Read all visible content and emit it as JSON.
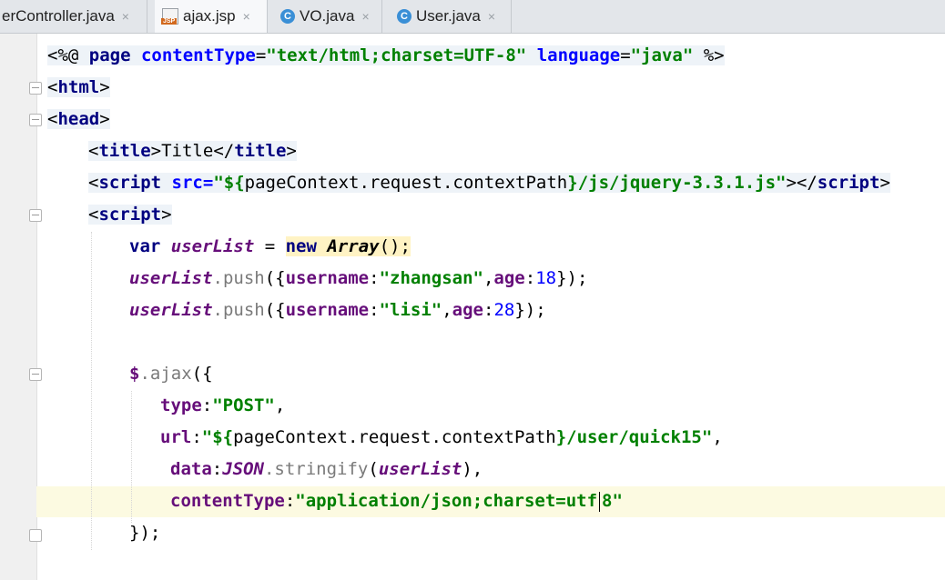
{
  "tabs": [
    {
      "label": "erController.java",
      "icon": "none",
      "active": false
    },
    {
      "label": "ajax.jsp",
      "icon": "jsp-file-icon",
      "active": true
    },
    {
      "label": "VO.java",
      "icon": "class-icon",
      "active": false
    },
    {
      "label": "User.java",
      "icon": "class-icon",
      "active": false
    }
  ],
  "tab_close": "×",
  "jsp_badge": "JSP",
  "class_badge": "C",
  "code": {
    "l1": {
      "a": "<%@ ",
      "b": "page ",
      "c": "contentType",
      "d": "=",
      "e": "\"text/html;charset=UTF-8\"",
      "f": " language",
      "g": "=",
      "h": "\"java\"",
      "i": " %>"
    },
    "l2": {
      "a": "<",
      "b": "html",
      "c": ">"
    },
    "l3": {
      "a": "<",
      "b": "head",
      "c": ">"
    },
    "l4": {
      "a": "<",
      "b": "title",
      "c": ">",
      "d": "Title",
      "e": "</",
      "f": "title",
      "g": ">"
    },
    "l5": {
      "a": "<",
      "b": "script ",
      "c": "src",
      "d": "=",
      "e": "\"${",
      "f": "pageContext.request.contextPath",
      "g": "}/js/jquery-3.3.1.js\"",
      "h": "></",
      "i": "script",
      "j": ">"
    },
    "l6": {
      "a": "<",
      "b": "script",
      "c": ">"
    },
    "l7": {
      "a": "var ",
      "b": "userList",
      "c": " = ",
      "d": "new ",
      "e": "Array",
      "f": "();"
    },
    "l8": {
      "a": "userList",
      "b": ".push",
      "c": "({",
      "d": "username",
      "e": ":",
      "f": "\"zhangsan\"",
      "g": ",",
      "h": "age",
      "i": ":",
      "j": "18",
      "k": "});"
    },
    "l9": {
      "a": "userList",
      "b": ".push",
      "c": "({",
      "d": "username",
      "e": ":",
      "f": "\"lisi\"",
      "g": ",",
      "h": "age",
      "i": ":",
      "j": "28",
      "k": "});"
    },
    "l11": {
      "a": "$",
      "b": ".ajax",
      "c": "({"
    },
    "l12": {
      "a": "type",
      "b": ":",
      "c": "\"POST\"",
      "d": ","
    },
    "l13": {
      "a": "url",
      "b": ":",
      "c": "\"${",
      "d": "pageContext.request.contextPath",
      "e": "}/user/quick15\"",
      "f": ","
    },
    "l14": {
      "a": "data",
      "b": ":",
      "c": "JSON",
      "d": ".stringify",
      "e": "(",
      "f": "userList",
      "g": "),"
    },
    "l15": {
      "a": "contentType",
      "b": ":",
      "c": "\"application/json;charset=utf",
      "d": "8\""
    },
    "l16": {
      "a": "});"
    }
  },
  "colors": {
    "keyword": "#000080",
    "string": "#008000",
    "variable": "#660e7a",
    "current_line": "#fcfae1"
  }
}
